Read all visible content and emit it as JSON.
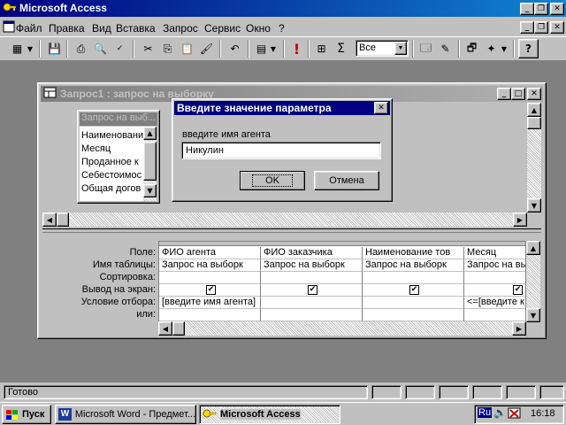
{
  "app": {
    "title": "Microsoft Access"
  },
  "menu": [
    "Файл",
    "Правка",
    "Вид",
    "Вставка",
    "Запрос",
    "Сервис",
    "Окно",
    "?"
  ],
  "toolbar": {
    "combo_value": "Все",
    "sigma": "Σ",
    "exclaim": "!"
  },
  "query_window": {
    "title": "Запрос1 : запрос на выборку"
  },
  "table_box": {
    "title": "Запрос на выб...",
    "fields": [
      "Наименовани",
      "Месяц",
      "Проданное к",
      "Себестоимос",
      "Общая догов"
    ]
  },
  "grid": {
    "row_labels": [
      "Поле:",
      "Имя таблицы:",
      "Сортировка:",
      "Вывод на экран:",
      "Условие отбора:",
      "или:"
    ],
    "columns": [
      {
        "field": "ФИО агента",
        "table": "Запрос на выборк",
        "show": true,
        "criteria": "[введите имя агента]"
      },
      {
        "field": "ФИО заказчика",
        "table": "Запрос на выборк",
        "show": true,
        "criteria": ""
      },
      {
        "field": "Наименование тов",
        "table": "Запрос на выборк",
        "show": true,
        "criteria": ""
      },
      {
        "field": "Месяц",
        "table": "Запрос на выбо",
        "show": true,
        "criteria": "<=[введите к"
      }
    ]
  },
  "dialog": {
    "title": "Введите значение параметра",
    "prompt": "введите имя агента",
    "value": "Никулин",
    "ok": "OK",
    "cancel": "Отмена"
  },
  "status": {
    "text": "Готово"
  },
  "taskbar": {
    "start": "Пуск",
    "items": [
      "Microsoft Word - Предмет...",
      "Microsoft Access"
    ],
    "lang": "Ru",
    "time": "16:18"
  }
}
